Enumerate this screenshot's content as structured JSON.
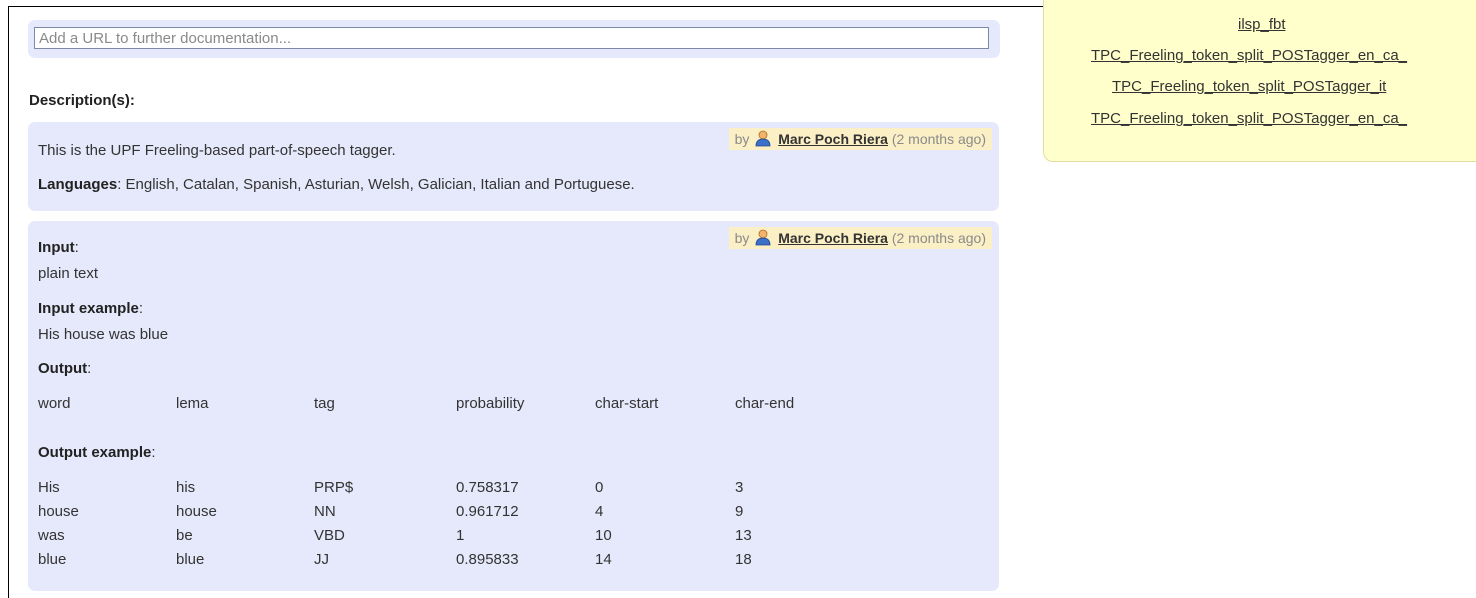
{
  "url_field": {
    "placeholder": "Add a URL to further documentation..."
  },
  "descriptions_heading": "Description(s):",
  "description1": {
    "by_prefix": "by",
    "author": "Marc Poch Riera",
    "time": "(2 months ago)",
    "text": "This is the UPF Freeling-based part-of-speech tagger.",
    "languages_label": "Languages",
    "languages_text": ": English, Catalan, Spanish, Asturian, Welsh, Galician, Italian and Portuguese."
  },
  "description2": {
    "by_prefix": "by",
    "author": "Marc Poch Riera",
    "time": "(2 months ago)",
    "input_label": "Input",
    "input_value": "plain text",
    "input_example_label": "Input example",
    "input_example_value": "His house was blue",
    "output_label": "Output",
    "output_columns": [
      "word",
      "lema",
      "tag",
      "probability",
      "char-start",
      "char-end"
    ],
    "output_example_label": "Output example",
    "output_rows": [
      [
        "His",
        "his",
        "PRP$",
        "0.758317",
        "0",
        "3"
      ],
      [
        "house",
        "house",
        "NN",
        "0.961712",
        "4",
        "9"
      ],
      [
        "was",
        "be",
        "VBD",
        "1",
        "10",
        "13"
      ],
      [
        "blue",
        "blue",
        "JJ",
        "0.895833",
        "14",
        "18"
      ]
    ],
    "colon": ":"
  },
  "sidebar": {
    "links": [
      "ilsp_fbt",
      "TPC_Freeling_token_split_POSTagger_en_ca_",
      "TPC_Freeling_token_split_POSTagger_it",
      "TPC_Freeling_token_split_POSTagger_en_ca_"
    ]
  },
  "colors": {
    "panel_bg": "#e6e9fb",
    "byline_bg": "#fbefc6",
    "sidebar_bg": "#ffffcc"
  }
}
